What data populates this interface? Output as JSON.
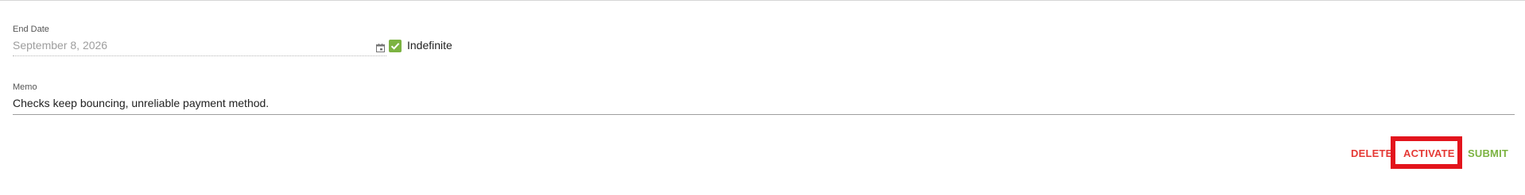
{
  "form": {
    "end_date": {
      "label": "End Date",
      "value": "September 8, 2026",
      "icon": "calendar-icon"
    },
    "indefinite": {
      "label": "Indefinite",
      "checked": true
    },
    "memo": {
      "label": "Memo",
      "value": "Checks keep bouncing, unreliable payment method."
    }
  },
  "actions": {
    "delete_label": "DELETE",
    "activate_label": "ACTIVATE",
    "submit_label": "SUBMIT"
  },
  "colors": {
    "danger": "#e53935",
    "success": "#7cb342",
    "highlight": "#e3141c"
  }
}
